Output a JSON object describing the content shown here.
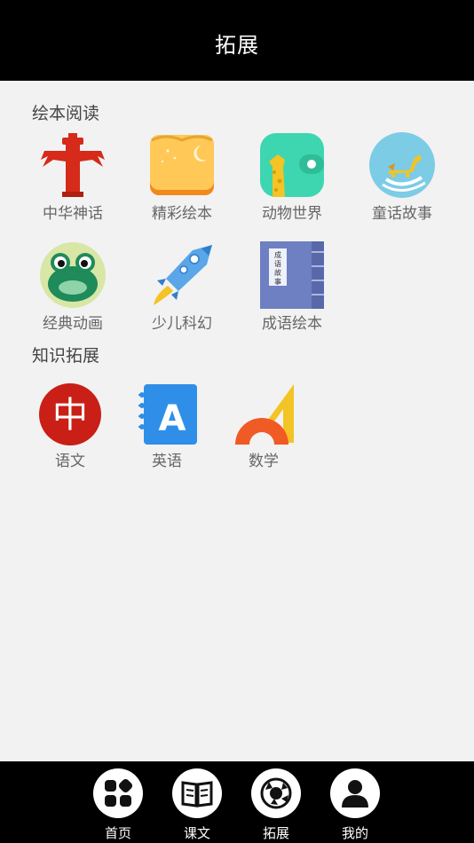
{
  "header": {
    "title": "拓展"
  },
  "sections": {
    "picture_books": {
      "title": "绘本阅读",
      "items": [
        {
          "label": "中华神话",
          "icon": "totem-pillar-icon"
        },
        {
          "label": "精彩绘本",
          "icon": "open-book-moon-icon"
        },
        {
          "label": "动物世界",
          "icon": "giraffe-icon"
        },
        {
          "label": "童话故事",
          "icon": "rocking-horse-icon"
        },
        {
          "label": "经典动画",
          "icon": "frog-icon"
        },
        {
          "label": "少儿科幻",
          "icon": "rocket-icon"
        },
        {
          "label": "成语绘本",
          "icon": "idiom-book-icon"
        }
      ],
      "idiom_book_cover_text": "成语故事"
    },
    "knowledge": {
      "title": "知识拓展",
      "items": [
        {
          "label": "语文",
          "icon": "chinese-character-icon",
          "glyph": "中"
        },
        {
          "label": "英语",
          "icon": "english-notebook-icon",
          "glyph": "A"
        },
        {
          "label": "数学",
          "icon": "protractor-ruler-icon"
        }
      ]
    }
  },
  "bottom_nav": {
    "items": [
      {
        "label": "首页",
        "icon": "home-grid-icon"
      },
      {
        "label": "课文",
        "icon": "textbook-icon"
      },
      {
        "label": "拓展",
        "icon": "explore-ball-icon"
      },
      {
        "label": "我的",
        "icon": "user-icon"
      }
    ]
  },
  "colors": {
    "header_bg": "#000000",
    "page_bg": "#f2f2f2",
    "text_gray": "#666666"
  }
}
